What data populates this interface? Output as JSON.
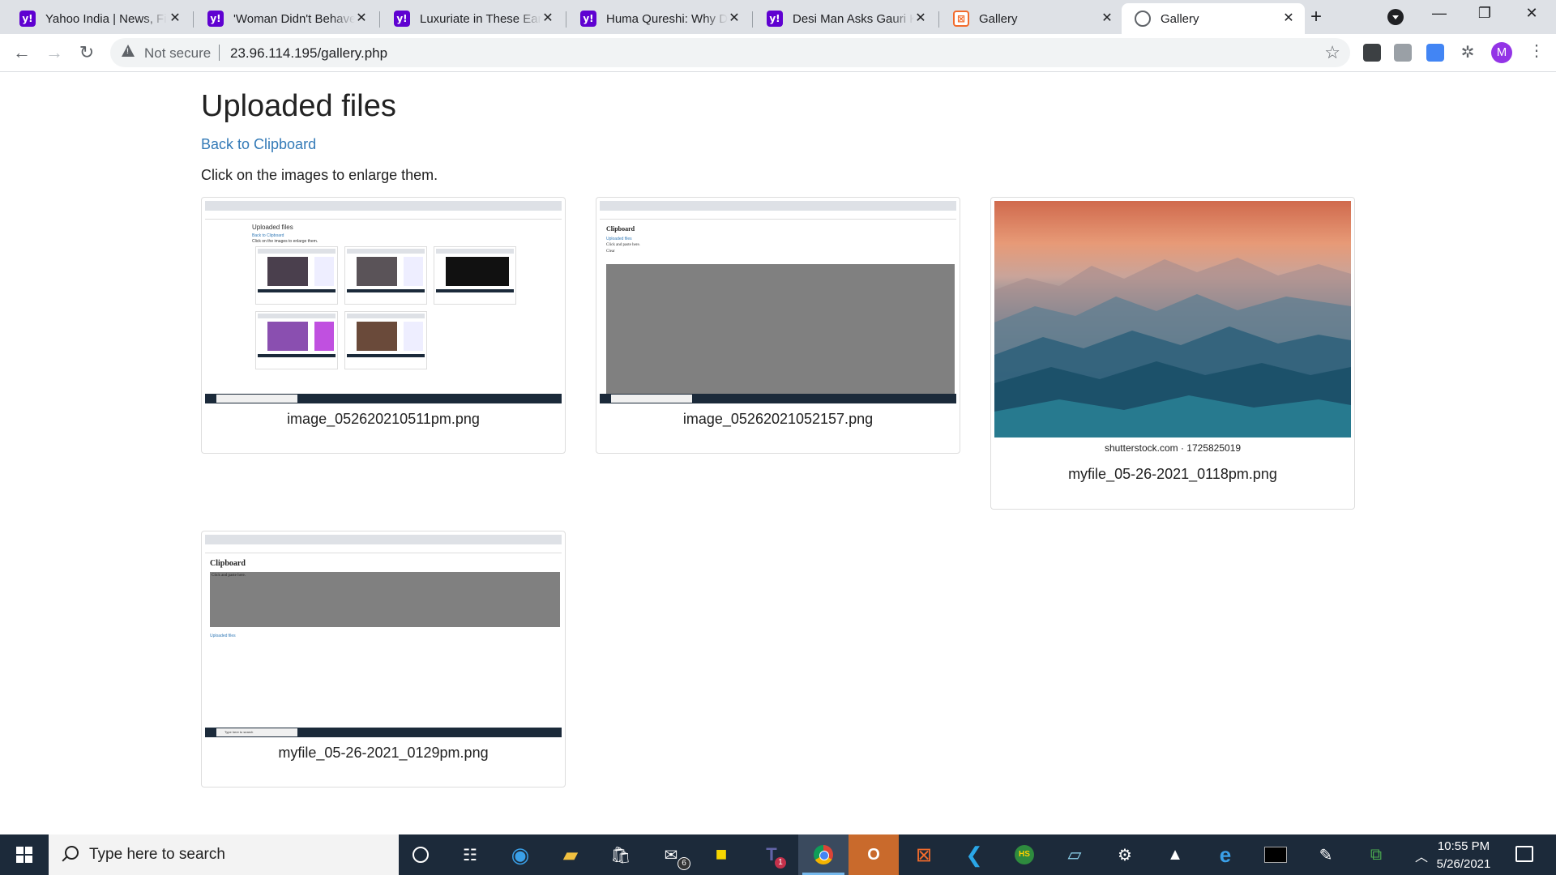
{
  "browser": {
    "tabs": [
      {
        "title": "Yahoo India | News, Finance, Cricket"
      },
      {
        "title": "'Woman Didn't Behave Like This'"
      },
      {
        "title": "Luxuriate in These Earrings"
      },
      {
        "title": "Huma Qureshi: Why Did She"
      },
      {
        "title": "Desi Man Asks Gauri Khan"
      },
      {
        "title": "Gallery"
      },
      {
        "title": "Gallery"
      }
    ],
    "security_label": "Not secure",
    "url": "23.96.114.195/gallery.php",
    "profile_initial": "M"
  },
  "page": {
    "heading": "Uploaded files",
    "back_link": "Back to Clipboard",
    "instructions": "Click on the images to enlarge them.",
    "images": [
      {
        "filename": "image_052620210511pm.png"
      },
      {
        "filename": "image_05262021052157.png"
      },
      {
        "filename": "myfile_05-26-2021_0118pm.png",
        "watermark": "shutterstock.com · 1725825019"
      },
      {
        "filename": "myfile_05-26-2021_0129pm.png"
      }
    ]
  },
  "thumbnails": {
    "gallery_heading": "Uploaded files",
    "gallery_link": "Back to Clipboard",
    "gallery_hint": "Click on the images to enlarge them.",
    "clipboard_title": "Clipboard",
    "clipboard_link": "Uploaded files",
    "clipboard_hint": "Click and paste here.",
    "clear_label": "Clear",
    "search_placeholder": "Type here to search"
  },
  "taskbar": {
    "search_placeholder": "Type here to search",
    "time": "10:55 PM",
    "date": "5/26/2021",
    "mail_badge": "6",
    "teams_badge": "1"
  },
  "colors": {
    "link": "#337ab7",
    "yahoo": "#5f01d1",
    "taskbar": "#1c2a3a"
  }
}
